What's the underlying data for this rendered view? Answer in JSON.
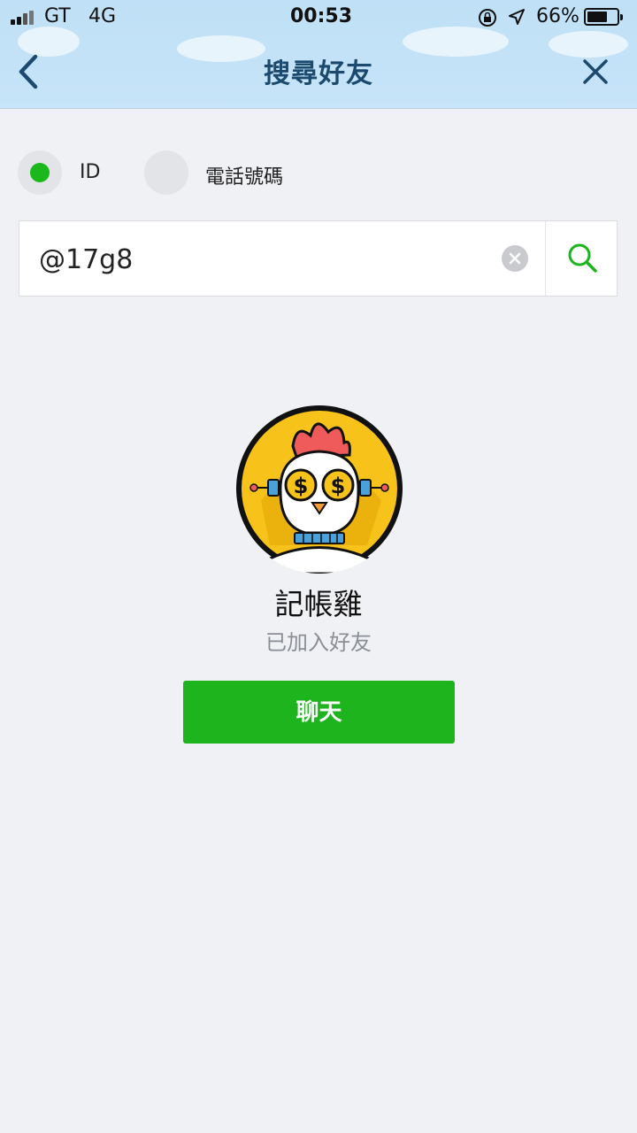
{
  "status_bar": {
    "carrier": "GT",
    "network": "4G",
    "time": "00:53",
    "battery": "66%",
    "battery_level": 0.66,
    "icons": [
      "signal-icon",
      "orientation-lock-icon",
      "location-arrow-icon",
      "battery-icon"
    ]
  },
  "header": {
    "title": "搜尋好友",
    "back_icon": "chevron-left-icon",
    "close_icon": "close-icon"
  },
  "search_type": {
    "options": [
      {
        "label": "ID",
        "selected": true
      },
      {
        "label": "電話號碼",
        "selected": false
      }
    ]
  },
  "search": {
    "value": "@17g8",
    "clear_icon": "clear-icon",
    "search_icon": "search-icon"
  },
  "result": {
    "name": "記帳雞",
    "status": "已加入好友",
    "avatar_icon": "chicken-avatar"
  },
  "actions": {
    "chat_label": "聊天"
  },
  "colors": {
    "accent_green": "#1db41d",
    "header_bg": "#c2e2f7",
    "title_color": "#1c4a6e",
    "page_bg": "#f0f1f4"
  }
}
